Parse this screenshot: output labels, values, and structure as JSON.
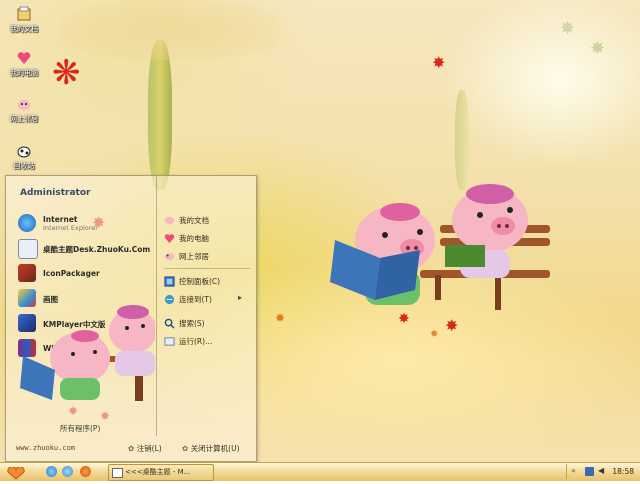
{
  "desktop": {
    "icons": [
      {
        "label": "我的文档",
        "icon": "my-documents-icon"
      },
      {
        "label": "我的电脑",
        "icon": "my-computer-icon"
      },
      {
        "label": "网上邻居",
        "icon": "network-icon"
      },
      {
        "label": "回收站",
        "icon": "recycle-bin-icon"
      }
    ]
  },
  "start_menu": {
    "user": "Administrator",
    "programs": [
      {
        "name": "Internet",
        "sub": "Internet Explorer",
        "icon": "internet-explorer-icon"
      },
      {
        "name": "桌酷主题Desk.ZhuoKu.Com",
        "sub": "",
        "icon": "zhuoku-theme-icon"
      },
      {
        "name": "IconPackager",
        "sub": "",
        "icon": "iconpackager-icon"
      },
      {
        "name": "画图",
        "sub": "",
        "icon": "paint-icon"
      },
      {
        "name": "KMPlayer中文版",
        "sub": "",
        "icon": "kmplayer-icon"
      },
      {
        "name": "WinRAR",
        "sub": "",
        "icon": "winrar-icon"
      }
    ],
    "all_programs": "所有程序(P)",
    "places": [
      {
        "label": "我的文档",
        "icon": "my-documents-icon"
      },
      {
        "label": "我的电脑",
        "icon": "my-computer-icon"
      },
      {
        "label": "网上邻居",
        "icon": "network-icon"
      },
      {
        "label": "控制面板(C)",
        "icon": "control-panel-icon"
      },
      {
        "label": "连接到(T)",
        "icon": "connect-to-icon"
      },
      {
        "label": "搜索(S)",
        "icon": "search-icon"
      },
      {
        "label": "运行(R)...",
        "icon": "run-icon"
      }
    ],
    "url": "www.zhuoku.com",
    "logoff": "注销(L)",
    "shutdown": "关闭计算机(U)"
  },
  "taskbar": {
    "window_title": "<<<桌酷主题 - M...",
    "clock": "18:58"
  },
  "colors": {
    "taskbar": "#e7c267",
    "leaf_red": "#d9281b",
    "pig_pink": "#f7b6c4"
  }
}
